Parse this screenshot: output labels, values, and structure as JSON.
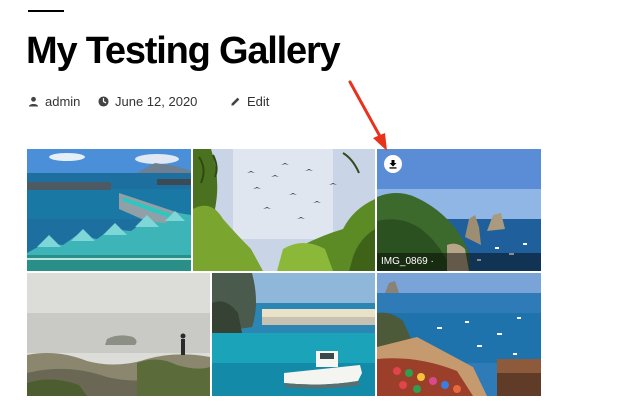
{
  "post": {
    "title": "My Testing Gallery",
    "author": "admin",
    "date": "June 12, 2020",
    "edit_label": "Edit"
  },
  "gallery": {
    "images": [
      {
        "id": 1
      },
      {
        "id": 2
      },
      {
        "id": 3,
        "caption": "IMG_0869 ·",
        "download_icon": "download-icon"
      },
      {
        "id": 4
      },
      {
        "id": 5
      },
      {
        "id": 6
      }
    ]
  },
  "colors": {
    "annotation_arrow": "#e8331c",
    "text": "#000000",
    "meta_text": "#333333"
  }
}
